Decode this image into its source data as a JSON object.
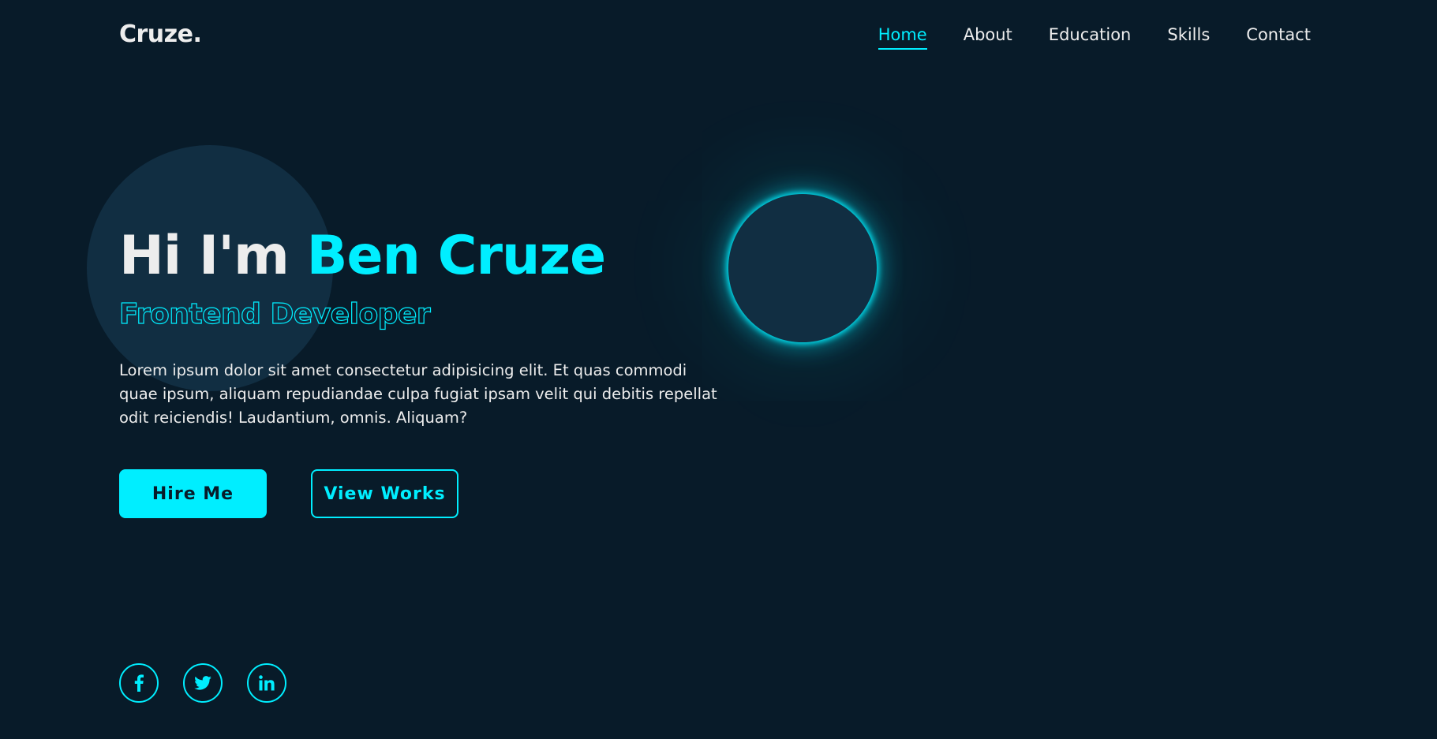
{
  "logo": "Cruze.",
  "nav": {
    "items": [
      "Home",
      "About",
      "Education",
      "Skills",
      "Contact"
    ],
    "active": "Home"
  },
  "hero": {
    "greeting": "Hi I'm",
    "name": "Ben Cruze",
    "role": "Frontend Developer",
    "description": "Lorem ipsum dolor sit amet consectetur adipisicing elit. Et quas commodi quae ipsum, aliquam repudiandae culpa fugiat ipsam velit qui debitis repellat odit reiciendis! Laudantium, omnis. Aliquam?"
  },
  "buttons": {
    "hire": "Hire Me",
    "works": "View Works"
  },
  "social": {
    "icons": [
      "facebook-icon",
      "twitter-icon",
      "linkedin-icon"
    ]
  },
  "colors": {
    "background": "#081b29",
    "accent": "#00eeff",
    "circle": "#112e42",
    "text": "#ededed"
  }
}
